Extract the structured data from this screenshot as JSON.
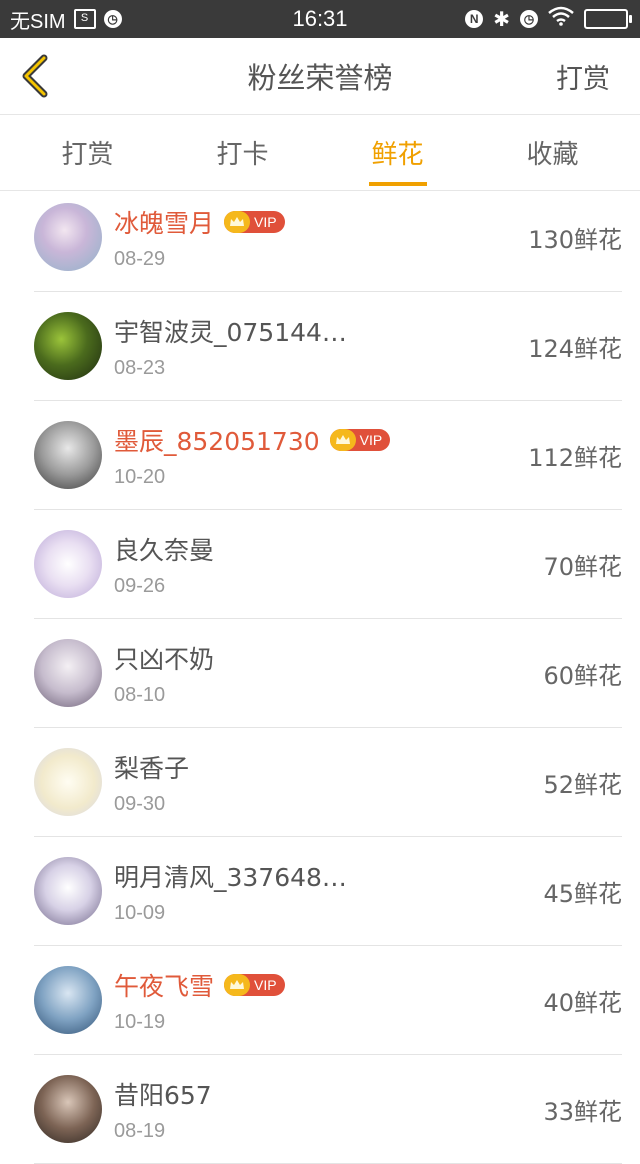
{
  "status_bar": {
    "carrier": "无SIM",
    "time": "16:31"
  },
  "header": {
    "title": "粉丝荣誉榜",
    "action_label": "打赏"
  },
  "tabs": [
    {
      "label": "打赏"
    },
    {
      "label": "打卡"
    },
    {
      "label": "鲜花",
      "active": true
    },
    {
      "label": "收藏"
    }
  ],
  "vip_badge_text": "VIP",
  "fans": [
    {
      "name": "冰魄雪月",
      "date": "08-29",
      "count": "130鲜花",
      "vip": true
    },
    {
      "name": "宇智波灵_075144…",
      "date": "08-23",
      "count": "124鲜花",
      "vip": false
    },
    {
      "name": "墨辰_852051730",
      "date": "10-20",
      "count": "112鲜花",
      "vip": true
    },
    {
      "name": "良久奈曼",
      "date": "09-26",
      "count": "70鲜花",
      "vip": false
    },
    {
      "name": "只凶不奶",
      "date": "08-10",
      "count": "60鲜花",
      "vip": false
    },
    {
      "name": "梨香子",
      "date": "09-30",
      "count": "52鲜花",
      "vip": false
    },
    {
      "name": "明月清风_337648…",
      "date": "10-09",
      "count": "45鲜花",
      "vip": false
    },
    {
      "name": "午夜飞雪",
      "date": "10-19",
      "count": "40鲜花",
      "vip": true
    },
    {
      "name": "昔阳657",
      "date": "08-19",
      "count": "33鲜花",
      "vip": false
    }
  ],
  "colors": {
    "accent": "#f0a000",
    "vip_name": "#e05a3a",
    "vip_badge": "#e0503a",
    "status_bar": "#3a3a3a"
  }
}
